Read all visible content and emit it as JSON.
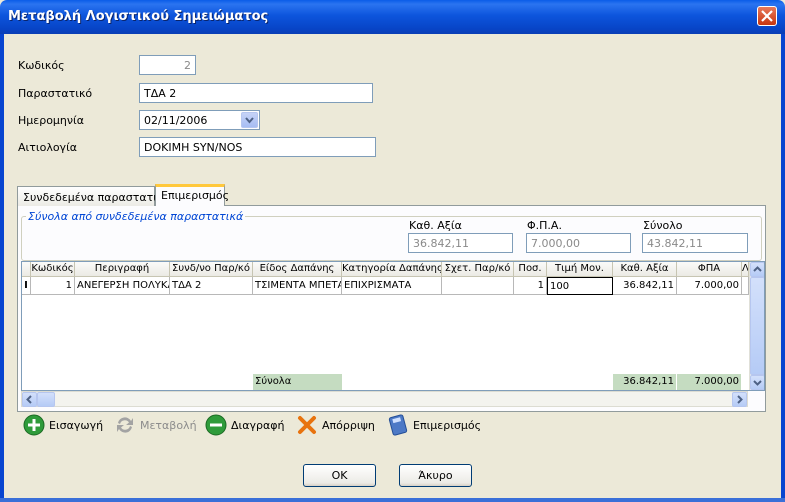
{
  "window": {
    "title": "Μεταβολή Λογιστικού Σημειώματος"
  },
  "form": {
    "code_label": "Κωδικός",
    "code_value": "2",
    "doc_label": "Παραστατικό",
    "doc_value": "ΤΔΑ 2",
    "date_label": "Ημερομηνία",
    "date_value": "02/11/2006",
    "reason_label": "Αιτιολογία",
    "reason_value": "DOKIMH SYN/NOS"
  },
  "tabs": [
    {
      "label": "Συνδεδεμένα παραστατικά"
    },
    {
      "label": "Επιμερισμός"
    }
  ],
  "totals_group": {
    "title": "Σύνολα από συνδεδεμένα παραστατικά",
    "net_label": "Καθ. Αξία",
    "net_value": "36.842,11",
    "vat_label": "Φ.Π.Α.",
    "vat_value": "7.000,00",
    "total_label": "Σύνολο",
    "total_value": "43.842,11"
  },
  "grid": {
    "headers": [
      "Κωδικός",
      "Περιγραφή",
      "Συνδ/νο Παρ/κό",
      "Είδος Δαπάνης",
      "Κατηγορία Δαπάνης",
      "Σχετ. Παρ/κό",
      "Ποσ.",
      "Τιμή Μον.",
      "Καθ. Αξία",
      "ΦΠΑ",
      "Λ"
    ],
    "row_indicator": "I",
    "rows": [
      [
        "1",
        "ΑΝΕΓΕΡΣΗ ΠΟΛΥΚΑΤΟΙΚΙΑΣ",
        "ΤΔΑ 2",
        "ΤΣΙΜΕΝΤΑ ΜΠΕΤΑ",
        "ΕΠΙΧΡΙΣΜΑΤΑ",
        "",
        "1",
        "100",
        "36.842,11",
        "7.000,00"
      ]
    ],
    "totals_label": "Σύνολα",
    "totals_net": "36.842,11",
    "totals_vat": "7.000,00"
  },
  "toolbar": {
    "insert": "Εισαγωγή",
    "edit": "Μεταβολή",
    "delete": "Διαγραφή",
    "reject": "Απόρριψη",
    "allocate": "Επιμερισμός"
  },
  "buttons": {
    "ok": "OK",
    "cancel": "Άκυρο"
  },
  "icons": [
    "close-icon",
    "dropdown-arrow-icon",
    "add-icon",
    "refresh-icon",
    "remove-icon",
    "reject-icon",
    "calculator-icon",
    "scroll-up-icon",
    "scroll-down-icon",
    "scroll-left-icon",
    "scroll-right-icon",
    "text-cursor-icon"
  ],
  "colors": {
    "title_bar": "#0845d0",
    "group_title": "#0046d5",
    "totals_row": "#c5dcc1",
    "active_tab": "#ffc83c"
  }
}
